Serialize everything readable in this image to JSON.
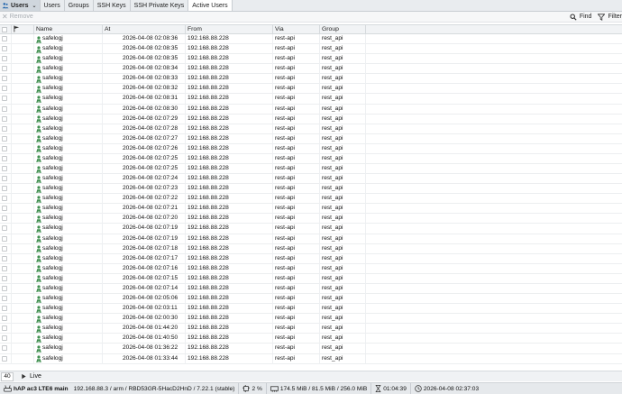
{
  "tabs": {
    "main_label": "Users",
    "items": [
      "Users",
      "Groups",
      "SSH Keys",
      "SSH Private Keys",
      "Active Users"
    ],
    "active": "Active Users"
  },
  "toolbar": {
    "remove_label": "Remove",
    "find_label": "Find",
    "filter_label": "Filter"
  },
  "columns": [
    "Name",
    "At",
    "From",
    "Via",
    "Group"
  ],
  "rows": [
    {
      "name": "safelogj",
      "at": "2026-04-08 02:08:36",
      "from": "192.168.88.228",
      "via": "rest-api",
      "group": "rest_api"
    },
    {
      "name": "safelogj",
      "at": "2026-04-08 02:08:35",
      "from": "192.168.88.228",
      "via": "rest-api",
      "group": "rest_api"
    },
    {
      "name": "safelogj",
      "at": "2026-04-08 02:08:35",
      "from": "192.168.88.228",
      "via": "rest-api",
      "group": "rest_api"
    },
    {
      "name": "safelogj",
      "at": "2026-04-08 02:08:34",
      "from": "192.168.88.228",
      "via": "rest-api",
      "group": "rest_api"
    },
    {
      "name": "safelogj",
      "at": "2026-04-08 02:08:33",
      "from": "192.168.88.228",
      "via": "rest-api",
      "group": "rest_api"
    },
    {
      "name": "safelogj",
      "at": "2026-04-08 02:08:32",
      "from": "192.168.88.228",
      "via": "rest-api",
      "group": "rest_api"
    },
    {
      "name": "safelogj",
      "at": "2026-04-08 02:08:31",
      "from": "192.168.88.228",
      "via": "rest-api",
      "group": "rest_api"
    },
    {
      "name": "safelogj",
      "at": "2026-04-08 02:08:30",
      "from": "192.168.88.228",
      "via": "rest-api",
      "group": "rest_api"
    },
    {
      "name": "safelogj",
      "at": "2026-04-08 02:07:29",
      "from": "192.168.88.228",
      "via": "rest-api",
      "group": "rest_api"
    },
    {
      "name": "safelogj",
      "at": "2026-04-08 02:07:28",
      "from": "192.168.88.228",
      "via": "rest-api",
      "group": "rest_api"
    },
    {
      "name": "safelogj",
      "at": "2026-04-08 02:07:27",
      "from": "192.168.88.228",
      "via": "rest-api",
      "group": "rest_api"
    },
    {
      "name": "safelogj",
      "at": "2026-04-08 02:07:26",
      "from": "192.168.88.228",
      "via": "rest-api",
      "group": "rest_api"
    },
    {
      "name": "safelogj",
      "at": "2026-04-08 02:07:25",
      "from": "192.168.88.228",
      "via": "rest-api",
      "group": "rest_api"
    },
    {
      "name": "safelogj",
      "at": "2026-04-08 02:07:25",
      "from": "192.168.88.228",
      "via": "rest-api",
      "group": "rest_api"
    },
    {
      "name": "safelogj",
      "at": "2026-04-08 02:07:24",
      "from": "192.168.88.228",
      "via": "rest-api",
      "group": "rest_api"
    },
    {
      "name": "safelogj",
      "at": "2026-04-08 02:07:23",
      "from": "192.168.88.228",
      "via": "rest-api",
      "group": "rest_api"
    },
    {
      "name": "safelogj",
      "at": "2026-04-08 02:07:22",
      "from": "192.168.88.228",
      "via": "rest-api",
      "group": "rest_api"
    },
    {
      "name": "safelogj",
      "at": "2026-04-08 02:07:21",
      "from": "192.168.88.228",
      "via": "rest-api",
      "group": "rest_api"
    },
    {
      "name": "safelogj",
      "at": "2026-04-08 02:07:20",
      "from": "192.168.88.228",
      "via": "rest-api",
      "group": "rest_api"
    },
    {
      "name": "safelogj",
      "at": "2026-04-08 02:07:19",
      "from": "192.168.88.228",
      "via": "rest-api",
      "group": "rest_api"
    },
    {
      "name": "safelogj",
      "at": "2026-04-08 02:07:19",
      "from": "192.168.88.228",
      "via": "rest-api",
      "group": "rest_api"
    },
    {
      "name": "safelogj",
      "at": "2026-04-08 02:07:18",
      "from": "192.168.88.228",
      "via": "rest-api",
      "group": "rest_api"
    },
    {
      "name": "safelogj",
      "at": "2026-04-08 02:07:17",
      "from": "192.168.88.228",
      "via": "rest-api",
      "group": "rest_api"
    },
    {
      "name": "safelogj",
      "at": "2026-04-08 02:07:16",
      "from": "192.168.88.228",
      "via": "rest-api",
      "group": "rest_api"
    },
    {
      "name": "safelogj",
      "at": "2026-04-08 02:07:15",
      "from": "192.168.88.228",
      "via": "rest-api",
      "group": "rest_api"
    },
    {
      "name": "safelogj",
      "at": "2026-04-08 02:07:14",
      "from": "192.168.88.228",
      "via": "rest-api",
      "group": "rest_api"
    },
    {
      "name": "safelogj",
      "at": "2026-04-08 02:05:06",
      "from": "192.168.88.228",
      "via": "rest-api",
      "group": "rest_api"
    },
    {
      "name": "safelogj",
      "at": "2026-04-08 02:03:11",
      "from": "192.168.88.228",
      "via": "rest-api",
      "group": "rest_api"
    },
    {
      "name": "safelogj",
      "at": "2026-04-08 02:00:30",
      "from": "192.168.88.228",
      "via": "rest-api",
      "group": "rest_api"
    },
    {
      "name": "safelogj",
      "at": "2026-04-08 01:44:20",
      "from": "192.168.88.228",
      "via": "rest-api",
      "group": "rest_api"
    },
    {
      "name": "safelogj",
      "at": "2026-04-08 01:40:50",
      "from": "192.168.88.228",
      "via": "rest-api",
      "group": "rest_api"
    },
    {
      "name": "safelogj",
      "at": "2026-04-08 01:36:22",
      "from": "192.168.88.228",
      "via": "rest-api",
      "group": "rest_api"
    },
    {
      "name": "safelogj",
      "at": "2026-04-08 01:33:44",
      "from": "192.168.88.228",
      "via": "rest-api",
      "group": "rest_api"
    }
  ],
  "footer": {
    "count": "40",
    "live_label": "Live",
    "identity": "hAP ac3 LTE6 main",
    "device_info": "192.168.88.3 / arm / RBD53GR-5HacD2HnD / 7.22.1 (stable)",
    "cpu": "2 %",
    "memory": "174.5 MiB / 81.5 MiB / 256.0 MiB",
    "uptime": "01:04:39",
    "clock": "2026-04-08 02:37:03"
  },
  "colors": {
    "user_icon": "#3f8f4f",
    "accent": "#2b6cb0"
  }
}
